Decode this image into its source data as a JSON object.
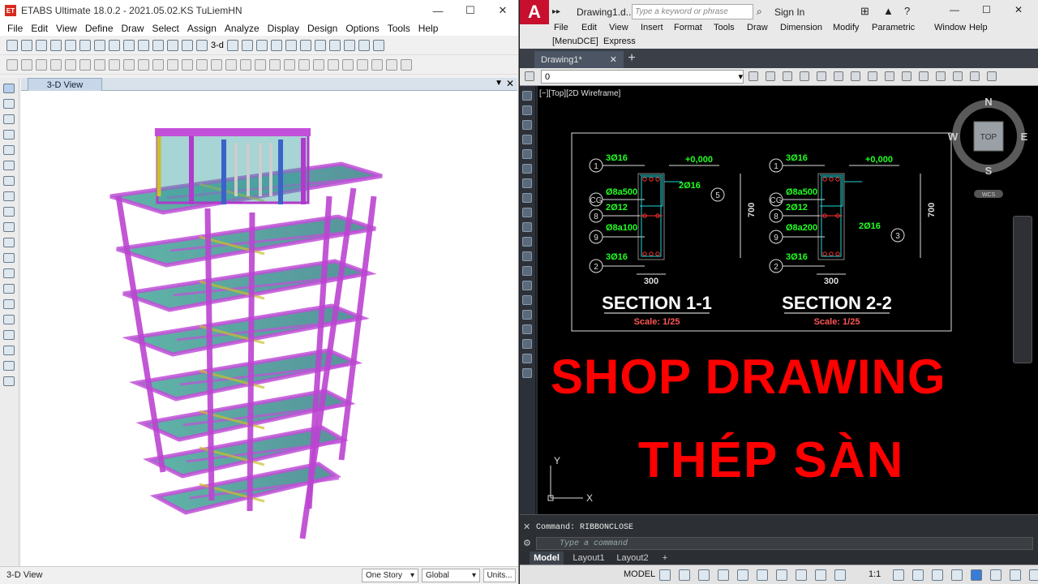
{
  "etabs": {
    "title": "ETABS Ultimate 18.0.2 - 2021.05.02.KS TuLiemHN",
    "logo": "ET",
    "menu": [
      "File",
      "Edit",
      "View",
      "Define",
      "Draw",
      "Select",
      "Assign",
      "Analyze",
      "Display",
      "Design",
      "Options",
      "Tools",
      "Help"
    ],
    "toolbar_text": "3-d",
    "view_tab": "3-D View",
    "status_left": "3-D View",
    "story_select": "One Story",
    "coord_select": "Global",
    "units_button": "Units..."
  },
  "autocad": {
    "logo": "A",
    "doc_title": "Drawing1.d...",
    "search_placeholder": "Type a keyword or phrase",
    "sign_in": "Sign In",
    "menu": [
      "File",
      "Edit",
      "View",
      "Insert",
      "Format",
      "Tools",
      "Draw",
      "Dimension",
      "Modify",
      "Parametric",
      "Window",
      "Help"
    ],
    "menu2": [
      "[MenuDCE]",
      "Express"
    ],
    "tab": "Drawing1*",
    "layer_value": "0",
    "viewport_label": "[−][Top][2D Wireframe]",
    "viewcube": {
      "top": "TOP",
      "n": "N",
      "s": "S",
      "e": "E",
      "w": "W",
      "wcs": "WCS"
    },
    "command_history": "Command: RIBBONCLOSE",
    "command_placeholder": "Type a command",
    "layout_tabs": [
      "Model",
      "Layout1",
      "Layout2"
    ],
    "status_model": "MODEL",
    "status_scale": "1:1",
    "drawing": {
      "s1": {
        "title": "SECTION 1-1",
        "scale": "Scale: 1/25",
        "width": "300",
        "height": "700",
        "labels": [
          "3Ø16",
          "Ø8a500",
          "2Ø12",
          "Ø8a100",
          "3Ø16",
          "2Ø16",
          "+0,000"
        ],
        "tags": [
          "1",
          "CG",
          "8",
          "9",
          "2",
          "5"
        ]
      },
      "s2": {
        "title": "SECTION 2-2",
        "scale": "Scale: 1/25",
        "width": "300",
        "height": "700",
        "labels": [
          "3Ø16",
          "Ø8a500",
          "2Ø12",
          "Ø8a200",
          "3Ø16",
          "2Ø16",
          "+0,000"
        ],
        "tags": [
          "1",
          "CG",
          "8",
          "9",
          "2",
          "3"
        ]
      }
    },
    "overlay_line1": "SHOP DRAWING",
    "overlay_line2": "THÉP SÀN"
  },
  "colors": {
    "autocad_red": "#c8102e",
    "overlay_red": "#ff0000",
    "rebar_green": "#22ff22",
    "etabs_magenta": "#cc44dd"
  }
}
